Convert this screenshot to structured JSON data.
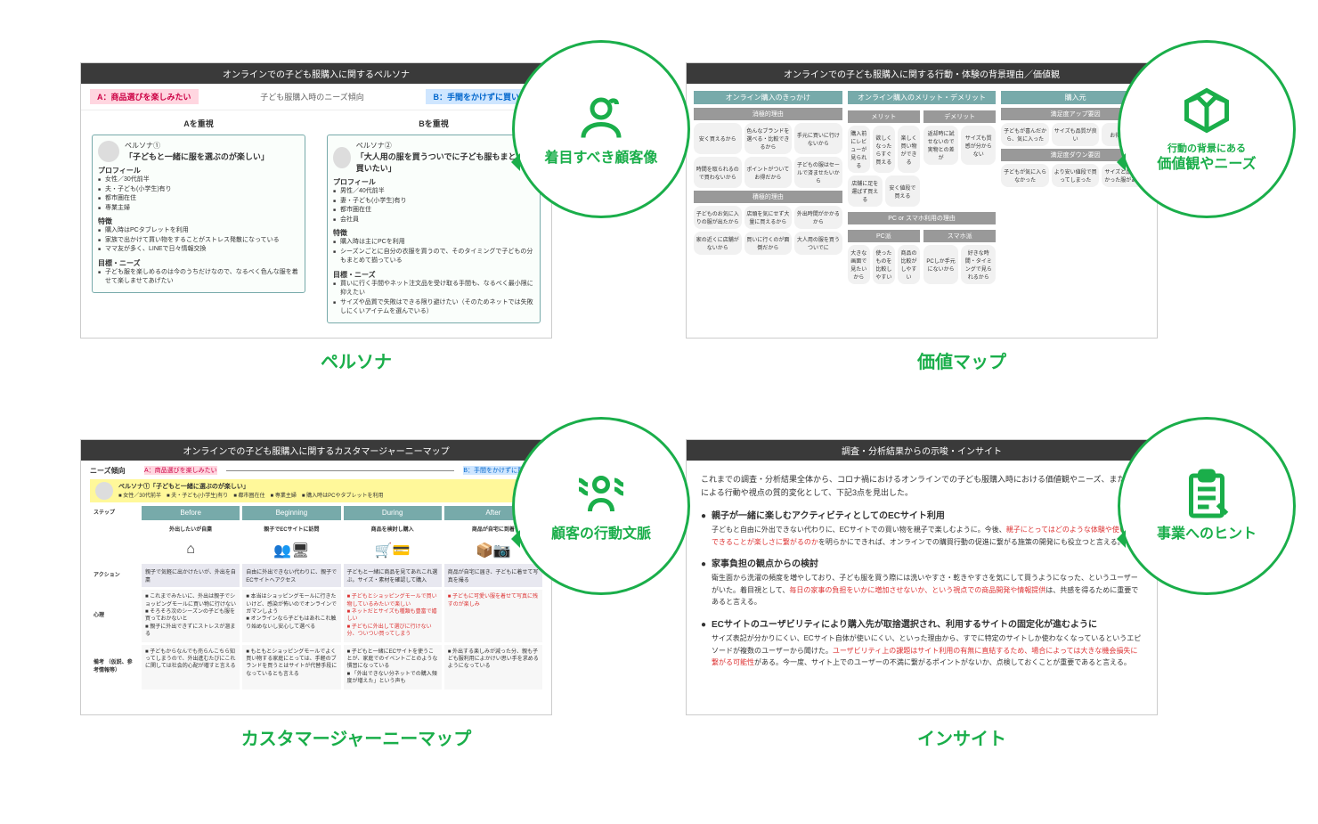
{
  "quads": {
    "persona": {
      "panel_title": "オンラインでの子ども服購入に関するペルソナ",
      "caption": "ペルソナ",
      "bubble": "着目すべき顧客像",
      "needs_label": "子ども服購入時のニーズ傾向",
      "tagA": "A：商品選びを楽しみたい",
      "tagB": "B：手間をかけずに買いたい",
      "colA_title": "Aを重視",
      "colB_title": "Bを重視",
      "p1": {
        "name": "ペルソナ①",
        "quote": "「子どもと一緒に服を選ぶのが楽しい」",
        "profile_h": "プロフィール",
        "profile": [
          "女性／30代前半",
          "夫・子ども(小学生)有り",
          "都市圏在住",
          "専業主婦"
        ],
        "trait_h": "特徴",
        "traits": [
          "購入時はPCタブレットを利用",
          "家族で出かけて買い物をすることがストレス発散になっている",
          "ママ友が多く、LINEで日々情報交換"
        ],
        "goal_h": "目標・ニーズ",
        "goals": [
          "子ども服を楽しめるのは今のうちだけなので、なるべく色んな服を着せて楽しませてあげたい"
        ]
      },
      "p2": {
        "name": "ペルソナ②",
        "quote": "「大人用の服を買うついでに子ども服もまとめて買いたい」",
        "profile_h": "プロフィール",
        "profile": [
          "男性／40代前半",
          "妻・子ども(小学生)有り",
          "都市圏在住",
          "会社員"
        ],
        "trait_h": "特徴",
        "traits": [
          "購入時は主にPCを利用",
          "シーズンごとに自分の衣服を買うので、そのタイミングで子どもの分もまとめて揃っている"
        ],
        "goal_h": "目標・ニーズ",
        "goals": [
          "買いに行く手間やネット注文品を受け取る手間も、なるべく最小限に抑えたい",
          "サイズや品質で失敗はできる限り避けたい（そのためネットでは失敗しにくいアイテムを選んでいる）"
        ]
      }
    },
    "valuemap": {
      "panel_title": "オンラインでの子ども服購入に関する行動・体験の背景理由／価値観",
      "caption": "価値マップ",
      "bubble_small": "行動の背景にある",
      "bubble": "価値観やニーズ",
      "cols": [
        {
          "h": "オンライン購入のきっかけ",
          "subs": [
            {
              "t": "消極的理由",
              "cells": [
                "安く買えるから",
                "色んなブランドを選べる・比較できるから",
                "手元に買いに行けないから",
                "時間を取られるので買わないから",
                "ポイントがついてお得だから",
                "子どもの服はセールで済ませたいから"
              ]
            },
            {
              "t": "積極的理由",
              "cells": [
                "子どものお気に入りの服が出たから",
                "店頭を気にせず大量に買えるから",
                "外出時間がかかるから",
                "家の近くに店舗がないから",
                "買いに行くのが面倒だから",
                "大人用の服を買うついでに"
              ]
            }
          ]
        },
        {
          "h": "オンライン購入のメリット・デメリット",
          "half": [
            {
              "t": "メリット",
              "cells": [
                "購入前にレビューが見られる",
                "欲しくなったらすぐ買える",
                "楽しく買い物ができる",
                "店舗に足を運ばず買える",
                "安く値段で買える"
              ]
            },
            {
              "t": "デメリット",
              "cells": [
                "返却時に試せないので実物との差が",
                "サイズも質感が分からない"
              ]
            }
          ],
          "sub2": {
            "t": "PC or スマホ利用の理由",
            "half": [
              {
                "t": "PC派",
                "cells": [
                  "大きな画面で見たいから",
                  "使ったものを比較しやすい",
                  "商品の比較がしやすい"
                ]
              },
              {
                "t": "スマホ派",
                "cells": [
                  "PCしか手元にないから",
                  "好きな時間・タイミングで見られるから"
                ]
              }
            ]
          }
        },
        {
          "h": "購入元",
          "subs": [
            {
              "t": "満足度アップ要因",
              "cells": [
                "子どもが喜んだから、気に入った",
                "サイズも品質が良い",
                " お得に買えた"
              ]
            },
            {
              "t": "満足度ダウン要因",
              "cells": [
                "子どもが気に入らなかった",
                "より安い値段で買ってしまった",
                "サイズと品質が悪かった服があった"
              ]
            }
          ]
        }
      ]
    },
    "journey": {
      "panel_title": "オンラインでの子ども服購入に関するカスタマージャーニーマップ",
      "caption": "カスタマージャーニーマップ",
      "bubble": "顧客の行動文脈",
      "needs_label": "ニーズ傾向",
      "tagA": "A：商品選びを楽しみたい",
      "tagB": "B：手間をかけずに買いたい",
      "persona_tag": "ペルソナ①「子どもと一緒に選ぶのが楽しい」",
      "persona_meta": [
        "女性／30代前半",
        "夫・子ども(小学生)有り",
        "都市圏在住",
        "専業主婦",
        "購入時はPCやタブレットを利用"
      ],
      "steps": [
        "Before",
        "Beginning",
        "During",
        "After"
      ],
      "step_sub": [
        "外出したいが自粛",
        "親子でECサイトに訪問",
        "商品を検討し購入",
        "商品が自宅に到着"
      ],
      "rows": {
        "action": {
          "label": "アクション",
          "cells": [
            "親子で気軽に出かけたいが、外出を自粛",
            "自由に外出できない代わりに、親子でECサイトへアクセス",
            "子どもと一緒に商品を見てあれこれ選ぶ。サイズ・素材を確認して購入",
            "商品が自宅に届き、子どもに着せて写真を撮る"
          ]
        },
        "mind": {
          "label": "心理",
          "cells": [
            "これまでみたいに、外出は親子でショッピングモールに買い物に行けない\nそろそろ次のシーズンの子ども服を買っておかないと\n親子に外出できずにストレスが溜まる",
            "本当はショッピングモールに行きたいけど、感染が怖いのでオンラインでガマンしよう\nオンラインなら子どもはあれこれ触り始めないし安心して選べる",
            "子どもとショッピングモールで買い物しているみたいで楽しい\nネットだとサイズも種類も豊富で嬉しい\n子どもに外出して選びに行けない分、ついつい買ってしまう",
            "子どもに可愛い服を着せて写真に残すのが楽しみ"
          ]
        },
        "note": {
          "label": "備考\n（仮説、参考情報等）",
          "cells": [
            "子どもからなんでも売らんこちら知ってしまうので、外出進むたびにこれに関しては社会的心配が増すと言える",
            "もともとショッピングモールでよく買い物する家庭にとっては、手軽のブランドを買うとはサイトが代替手段になっているとも言える",
            "子どもと一緒にECサイトを使うことが、家庭でのイベントごとのような慣習になっている\n「外出できない分ネットでの購入頻度が増えた」という声も",
            "外出する楽しみが減った分、親も子ども服利用によかけい思い手を求めるようになっている"
          ]
        }
      }
    },
    "insight": {
      "panel_title": "調査・分析結果からの示唆・インサイト",
      "caption": "インサイト",
      "bubble": "事業へのヒント",
      "lead": "これまでの調査・分析結果全体から、コロナ禍におけるオンラインでの子ども服購入時における価値観やニーズ、またそれによる行動や視点の質的変化として、下記3点を見出した。",
      "points": [
        {
          "t": "親子が一緒に楽しむアクティビティとしてのECサイト利用",
          "b": "子どもと自由に外出できない代わりに、ECサイトでの買い物を親子で楽しむように。今後、",
          "hl": "親子にとってはどのような体験や使い方ができることが楽しさに繋がるのか",
          "b2": "を明らかにできれば、オンラインでの購買行動の促進に繋がる施策の開発にも役立つと言える。"
        },
        {
          "t": "家事負担の観点からの検討",
          "b": "衛生面から洗濯の頻度を増やしており、子ども服を買う際には洗いやすさ・乾きやすさを気にして買うようになった、というユーザーがいた。着目視として、",
          "hl": "毎日の家事の負担をいかに増加させないか、という視点での商品開発や情報提供",
          "b2": "は、共感を得るために重要であると言える。"
        },
        {
          "t": "ECサイトのユーザビリティにより購入先が取捨選択され、利用するサイトの固定化が進むように",
          "b": "サイズ表記が分かりにくい、ECサイト自体が使いにくい、といった理由から、すでに特定のサイトしか使わなくなっているというエピソードが複数のユーザーから聞けた。",
          "hl": "ユーザビリティ上の課題はサイト利用の有無に直結するため、場合によっては大きな機会損失に繋がる可能性",
          "b2": "がある。今一度、サイト上でのユーザーの不満に繋がるポイントがないか、点検しておくことが重要であると言える。"
        }
      ]
    }
  }
}
